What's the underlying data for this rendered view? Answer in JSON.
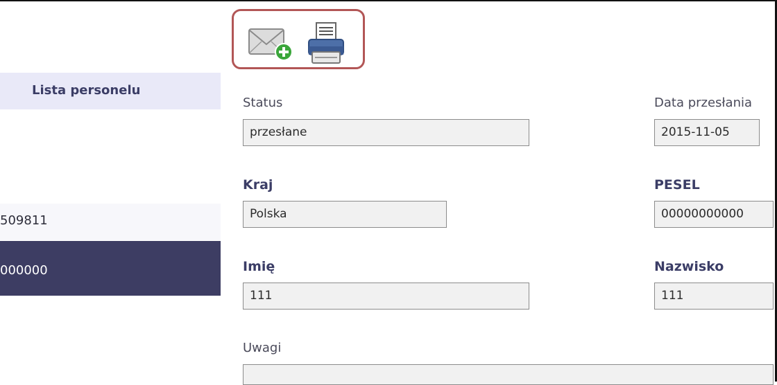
{
  "sidebar": {
    "header": "Lista personelu",
    "rows": [
      {
        "label": "509811"
      },
      {
        "label": "000000"
      }
    ]
  },
  "toolbar": {
    "icons": [
      "mail-add-icon",
      "print-icon"
    ]
  },
  "form": {
    "status": {
      "label": "Status",
      "value": "przesłane"
    },
    "data_przeslania": {
      "label": "Data przesłania",
      "value": "2015-11-05"
    },
    "kraj": {
      "label": "Kraj",
      "value": "Polska"
    },
    "pesel": {
      "label": "PESEL",
      "value": "00000000000"
    },
    "imie": {
      "label": "Imię",
      "value": "111"
    },
    "nazwisko": {
      "label": "Nazwisko",
      "value": "111"
    },
    "uwagi": {
      "label": "Uwagi",
      "value": ""
    }
  },
  "colors": {
    "toolbar_border": "#b25656",
    "sidebar_header_bg": "#e9e9f8",
    "selected_row_bg": "#3d3d63",
    "label_bold": "#3b3d66"
  }
}
